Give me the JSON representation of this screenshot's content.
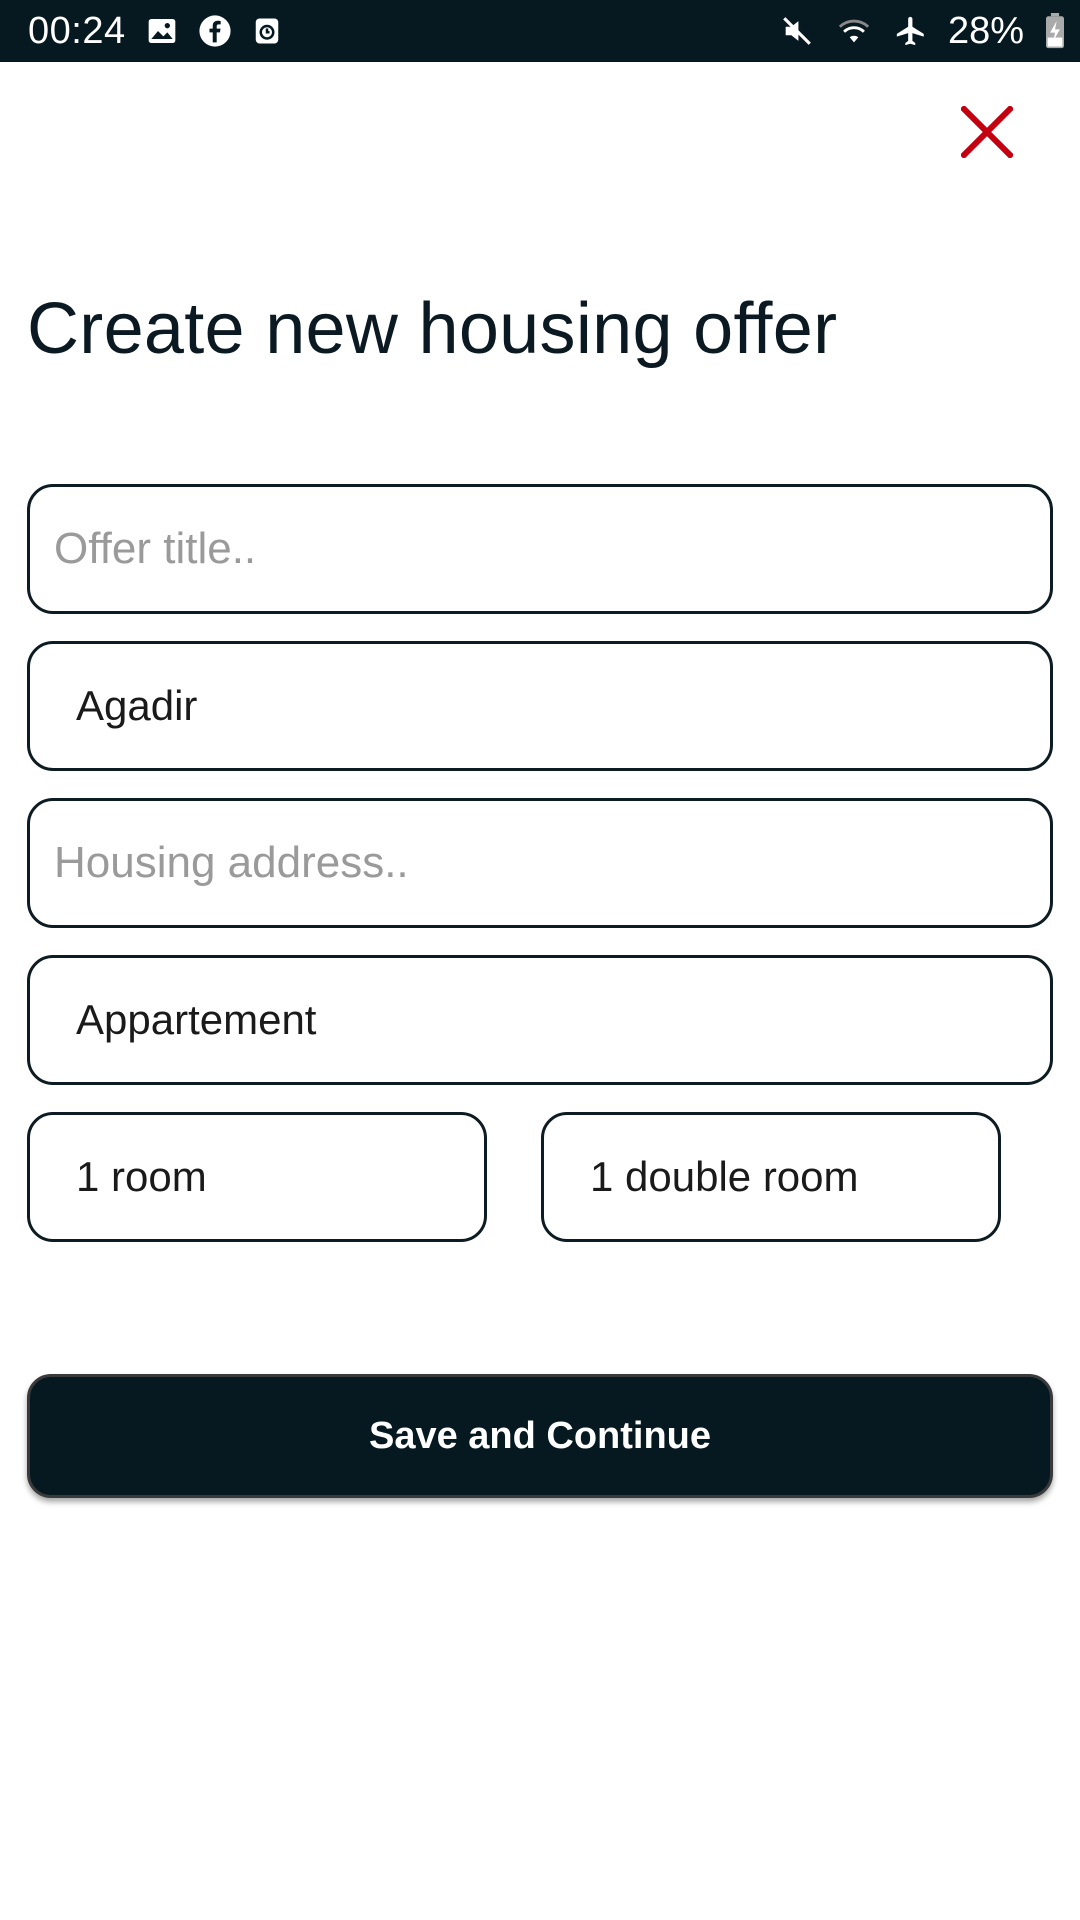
{
  "status_bar": {
    "time": "00:24",
    "left_icons": [
      "image-icon",
      "facebook-icon",
      "clock-app-icon"
    ],
    "right_icons": [
      "mute-icon",
      "wifi-icon",
      "airplane-icon",
      "battery-charging-icon"
    ],
    "battery": "28%",
    "background": "#061820"
  },
  "close_icon_color": "#c40010",
  "title": "Create new housing offer",
  "form": {
    "offer_title_placeholder": "Offer title..",
    "city_value": "Agadir",
    "address_placeholder": "Housing address..",
    "housing_type_value": "Appartement",
    "rooms_value": "1 room",
    "bed_type_value": "1 double room"
  },
  "save_button_label": "Save and Continue"
}
